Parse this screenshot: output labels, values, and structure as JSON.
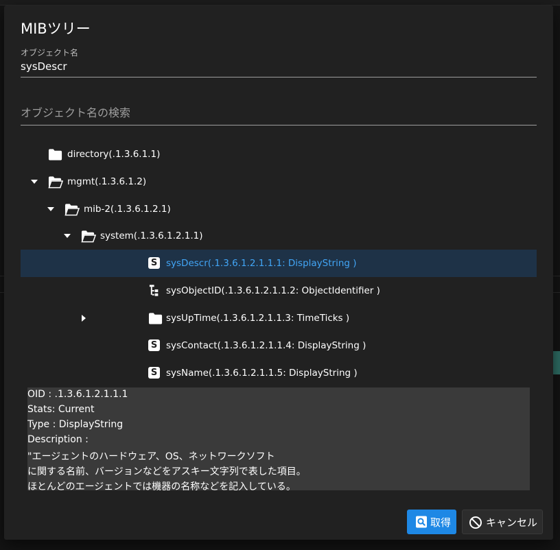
{
  "dialog": {
    "title": "MIBツリー",
    "object_name_label": "オブジェクト名",
    "object_name_value": "sysDescr",
    "search_placeholder": "オブジェクト名の検索"
  },
  "tree": [
    {
      "label": "directory(.1.3.6.1.1)",
      "caret": "none",
      "icon": "folder-icon",
      "selected": false
    },
    {
      "label": "mgmt(.1.3.6.1.2)",
      "caret": "expanded",
      "icon": "folder-open-icon",
      "selected": false
    },
    {
      "label": "mib-2(.1.3.6.1.2.1)",
      "caret": "expanded",
      "icon": "folder-open-icon",
      "selected": false
    },
    {
      "label": "system(.1.3.6.1.2.1.1)",
      "caret": "expanded",
      "icon": "folder-open-icon",
      "selected": false
    },
    {
      "label": "sysDescr(.1.3.6.1.2.1.1.1: DisplayString )",
      "caret": "none",
      "icon": "string-icon",
      "icon_text": "S",
      "selected": true
    },
    {
      "label": "sysObjectID(.1.3.6.1.2.1.1.2: ObjectIdentifier )",
      "caret": "none",
      "icon": "object-id-icon",
      "selected": false
    },
    {
      "label": "sysUpTime(.1.3.6.1.2.1.1.3: TimeTicks )",
      "caret": "collapsed",
      "icon": "folder-icon",
      "selected": false
    },
    {
      "label": "sysContact(.1.3.6.1.2.1.1.4: DisplayString )",
      "caret": "none",
      "icon": "string-icon",
      "icon_text": "S",
      "selected": false
    },
    {
      "label": "sysName(.1.3.6.1.2.1.1.5: DisplayString )",
      "caret": "none",
      "icon": "string-icon",
      "icon_text": "S",
      "selected": false
    }
  ],
  "detail": {
    "lines": [
      "OID  : .1.3.6.1.2.1.1.1",
      "Stats: Current",
      "Type : DisplayString",
      "Description :",
      "\"エージェントのハードウェア、OS、ネットワークソフト",
      "に関する名前、バージョンなどをアスキー文字列で表した項目。",
      "ほとんどのエージェントでは機器の名称などを記入している。"
    ]
  },
  "buttons": {
    "get_label": "取得",
    "cancel_label": "キャンセル"
  },
  "colors": {
    "dialog_bg": "#212121",
    "selected_row_bg": "#1e3247",
    "selected_text": "#42a5f5",
    "primary_button": "#1e88e5",
    "detail_bg": "#3a3a3a"
  }
}
